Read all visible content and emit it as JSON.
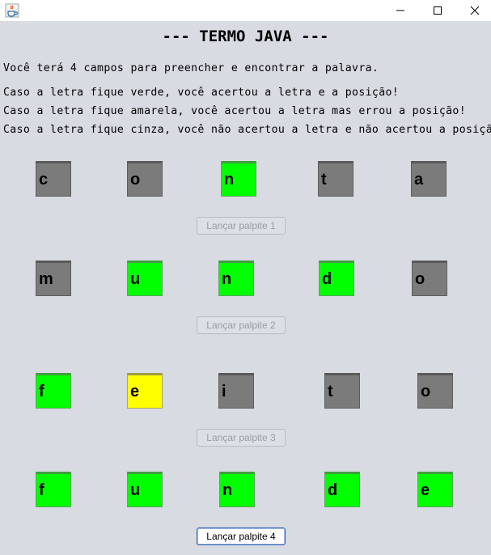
{
  "window": {
    "app_icon": "java-cup-icon",
    "controls": [
      "minimize-icon",
      "maximize-icon",
      "close-icon"
    ]
  },
  "header": {
    "title": "--- TERMO JAVA ---"
  },
  "instructions": [
    "Você terá 4 campos para preencher e encontrar a palavra.",
    "Caso a letra fique verde, você acertou a letra e a posição!",
    "Caso a letra fique amarela, você acertou a letra mas errou a posição!",
    "Caso a letra fique cinza, você não acertou a letra e não acertou a posição!"
  ],
  "colors": {
    "correct": "#00ff00",
    "misplaced": "#ffff00",
    "absent": "#7b7b7b"
  },
  "guesses": [
    {
      "letters": [
        "c",
        "o",
        "n",
        "t",
        "a"
      ],
      "states": [
        "absent",
        "absent",
        "correct",
        "absent",
        "absent"
      ],
      "button_label": "Lançar palpite 1",
      "button_enabled": false
    },
    {
      "letters": [
        "m",
        "u",
        "n",
        "d",
        "o"
      ],
      "states": [
        "absent",
        "correct",
        "correct",
        "correct",
        "absent"
      ],
      "button_label": "Lançar palpite 2",
      "button_enabled": false
    },
    {
      "letters": [
        "f",
        "e",
        "i",
        "t",
        "o"
      ],
      "states": [
        "correct",
        "misplaced",
        "absent",
        "absent",
        "absent"
      ],
      "button_label": "Lançar palpite 3",
      "button_enabled": false
    },
    {
      "letters": [
        "f",
        "u",
        "n",
        "d",
        "e"
      ],
      "states": [
        "correct",
        "correct",
        "correct",
        "correct",
        "correct"
      ],
      "button_label": "Lançar palpite 4",
      "button_enabled": true
    }
  ]
}
